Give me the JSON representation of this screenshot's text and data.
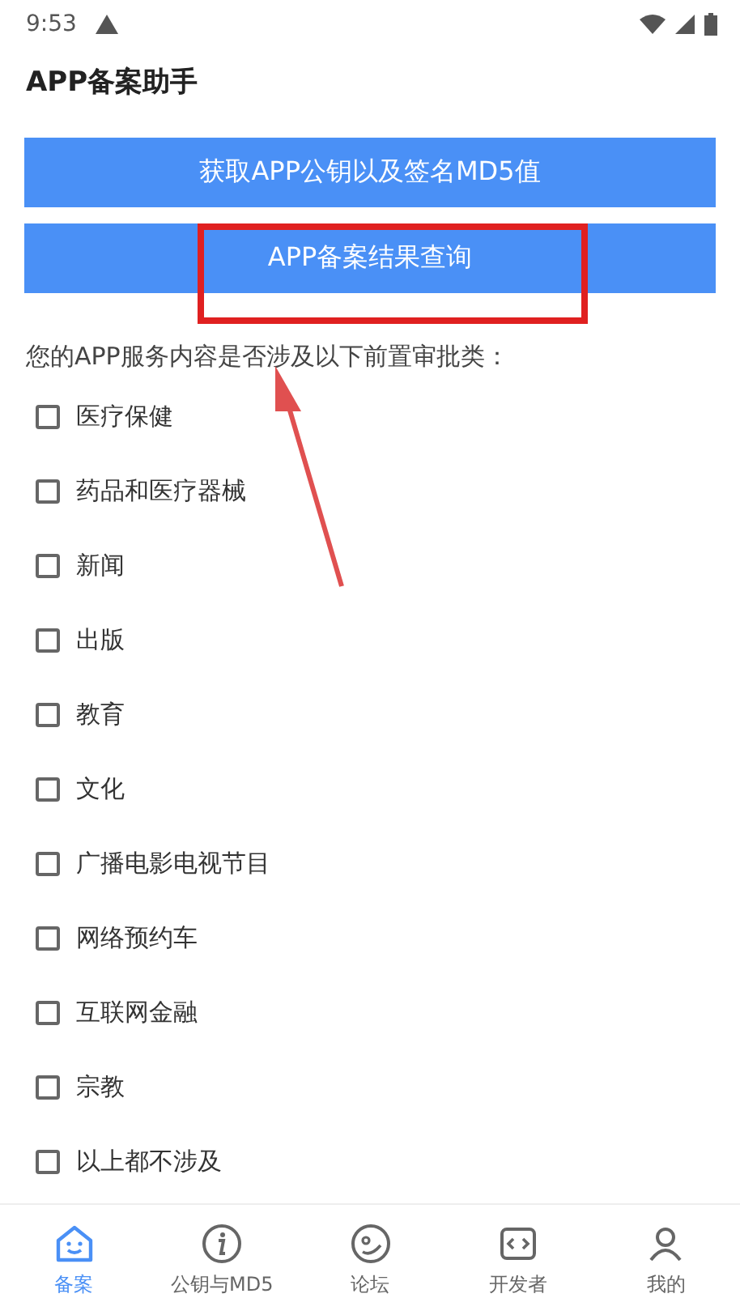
{
  "status_bar": {
    "time": "9:53"
  },
  "app_bar": {
    "title": "APP备案助手"
  },
  "buttons": [
    "获取APP公钥以及签名MD5值",
    "APP备案结果查询"
  ],
  "question": "您的APP服务内容是否涉及以下前置审批类：",
  "options": [
    {
      "label": "医疗保健",
      "checked": false
    },
    {
      "label": "药品和医疗器械",
      "checked": false
    },
    {
      "label": "新闻",
      "checked": false
    },
    {
      "label": "出版",
      "checked": false
    },
    {
      "label": "教育",
      "checked": false
    },
    {
      "label": "文化",
      "checked": false
    },
    {
      "label": "广播电影电视节目",
      "checked": false
    },
    {
      "label": "网络预约车",
      "checked": false
    },
    {
      "label": "互联网金融",
      "checked": false
    },
    {
      "label": "宗教",
      "checked": false
    },
    {
      "label": "以上都不涉及",
      "checked": false
    }
  ],
  "bottom_nav": [
    {
      "label": "备案",
      "selected": true
    },
    {
      "label": "公钥与MD5",
      "selected": false
    },
    {
      "label": "论坛",
      "selected": false
    },
    {
      "label": "开发者",
      "selected": false
    },
    {
      "label": "我的",
      "selected": false
    }
  ]
}
